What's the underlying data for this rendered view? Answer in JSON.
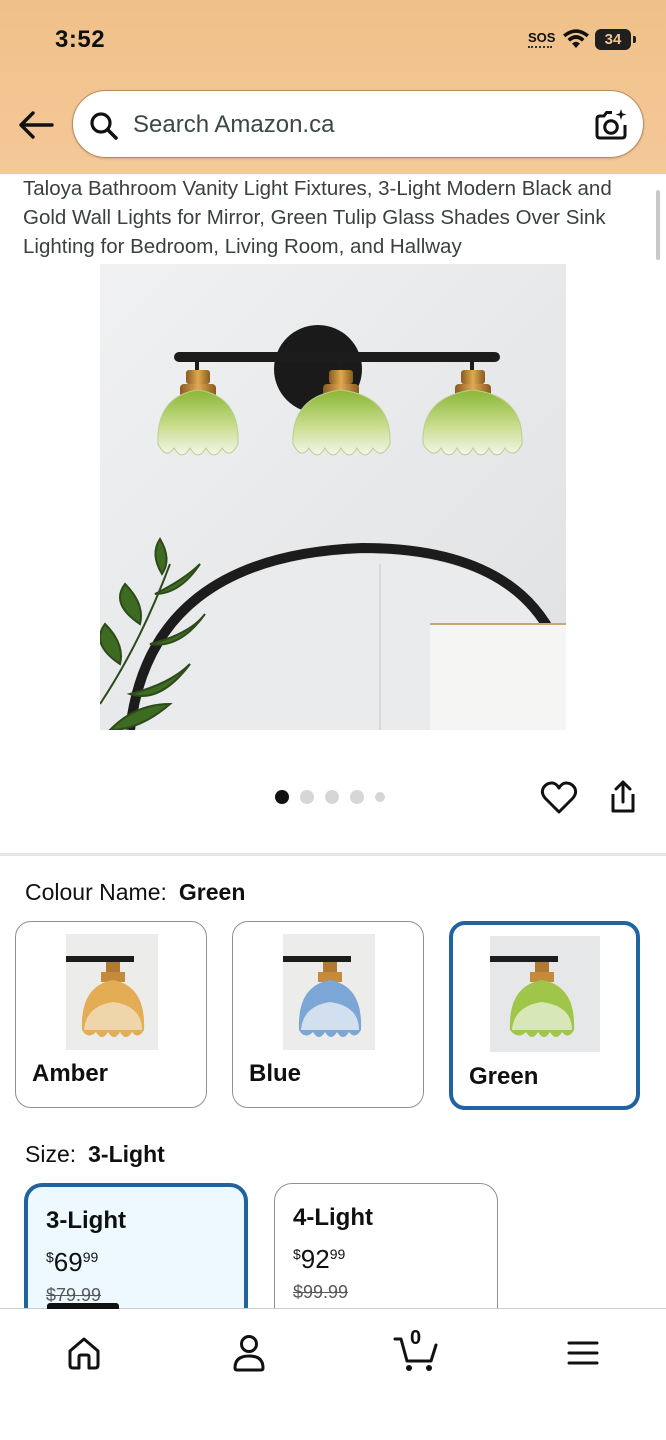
{
  "status_bar": {
    "time": "3:52",
    "sos": "SOS",
    "battery": "34"
  },
  "search": {
    "placeholder": "Search Amazon.ca"
  },
  "product": {
    "title": "Taloya Bathroom Vanity Light Fixtures, 3-Light Modern Black and Gold Wall Lights for Mirror, Green Tulip Glass Shades Over Sink Lighting for Bedroom, Living Room, and Hallway",
    "image_count": 5,
    "active_image": 1
  },
  "colour": {
    "label": "Colour Name:",
    "selected": "Green",
    "options": [
      {
        "name": "Amber",
        "glass_color": "#e3ad55"
      },
      {
        "name": "Blue",
        "glass_color": "#7ba6d6"
      },
      {
        "name": "Green",
        "glass_color": "#9fc64a"
      }
    ]
  },
  "size": {
    "label": "Size:",
    "selected": "3-Light",
    "options": [
      {
        "name": "3-Light",
        "price_currency": "$",
        "price_whole": "69",
        "price_fraction": "99",
        "list_price": "$79.99"
      },
      {
        "name": "4-Light",
        "price_currency": "$",
        "price_whole": "92",
        "price_fraction": "99",
        "list_price": "$99.99"
      }
    ]
  },
  "bottom_nav": {
    "cart_count": "0"
  },
  "colors": {
    "selected_border": "#2162a1",
    "header_bg": "#f3c592"
  }
}
